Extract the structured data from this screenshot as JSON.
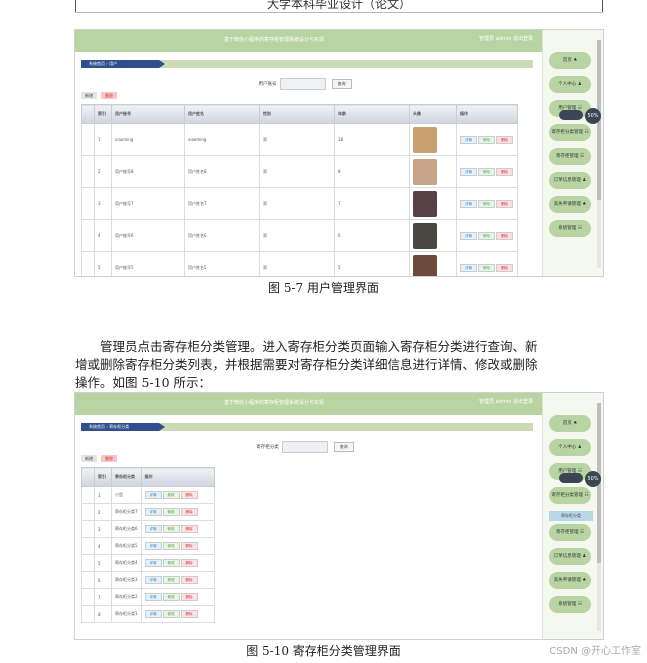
{
  "header": {
    "text": "大学本科毕业设计（论文）"
  },
  "shot1": {
    "system_title": "基于微信小程序的寄存柜管理系统设计与实现",
    "user_info": "管理员 admin 退出登录",
    "breadcrumb": "系统首页 › 用户",
    "search": {
      "label": "用户账号",
      "button": "查询"
    },
    "actions": {
      "add": "新增",
      "delete": "删除"
    },
    "columns": [
      "",
      "索引",
      "用户账号",
      "用户姓名",
      "性别",
      "年龄",
      "头像",
      "操作"
    ],
    "rows": [
      {
        "idx": "1",
        "account": "xiaoming",
        "name": "xiaoming",
        "gender": "男",
        "age": "18",
        "color": "#caa070"
      },
      {
        "idx": "2",
        "account": "用户账号8",
        "name": "用户姓名8",
        "gender": "男",
        "age": "8",
        "color": "#c6a489"
      },
      {
        "idx": "3",
        "account": "用户账号7",
        "name": "用户姓名7",
        "gender": "男",
        "age": "7",
        "color": "#574046"
      },
      {
        "idx": "4",
        "account": "用户账号6",
        "name": "用户姓名6",
        "gender": "男",
        "age": "6",
        "color": "#4a4642"
      },
      {
        "idx": "5",
        "account": "用户账号5",
        "name": "用户姓名5",
        "gender": "男",
        "age": "5",
        "color": "#6b4a3c"
      }
    ],
    "row_ops": [
      "详情",
      "修改",
      "删除"
    ],
    "sidebar": [
      "首页 ♠",
      "个人中心 ♟",
      "用户管理 ☷",
      "寄存柜分类管理 ☷",
      "寄存柜管理 ☰",
      "订单信息管理 ♟",
      "丢失申请管理 ♠",
      "系统管理 ☷"
    ],
    "badge": "50%",
    "caption": "图 5-7 用户管理界面"
  },
  "paragraph": {
    "line1": "管理员点击寄存柜分类管理。进入寄存柜分类页面输入寄存柜分类进行查询、新",
    "line2": "增或删除寄存柜分类列表，并根据需要对寄存柜分类详细信息进行详情、修改或删除",
    "line3": "操作。如图 5-10 所示："
  },
  "shot2": {
    "system_title": "基于微信小程序的寄存柜管理系统设计与实现",
    "user_info": "管理员 admin 退出登录",
    "breadcrumb": "系统首页 › 寄存柜分类",
    "search": {
      "label": "寄存柜分类",
      "button": "查询"
    },
    "actions": {
      "add": "新增",
      "delete": "删除"
    },
    "columns": [
      "",
      "索引",
      "寄存柜分类",
      "操作"
    ],
    "rows": [
      {
        "idx": "1",
        "name": "小型"
      },
      {
        "idx": "2",
        "name": "寄存柜分类7"
      },
      {
        "idx": "3",
        "name": "寄存柜分类6"
      },
      {
        "idx": "4",
        "name": "寄存柜分类5"
      },
      {
        "idx": "5",
        "name": "寄存柜分类4"
      },
      {
        "idx": "6",
        "name": "寄存柜分类3"
      },
      {
        "idx": "7",
        "name": "寄存柜分类2"
      },
      {
        "idx": "8",
        "name": "寄存柜分类1"
      }
    ],
    "row_ops": [
      "详情",
      "修改",
      "删除"
    ],
    "sidebar": [
      "首页 ♠",
      "个人中心 ♟",
      "用户管理 ☷",
      "寄存柜分类管理 ☷",
      "寄存柜分类",
      "寄存柜管理 ☰",
      "订单信息管理 ♟",
      "丢失申请管理 ♠",
      "系统管理 ☷"
    ],
    "badge": "50%",
    "caption": "图 5-10 寄存柜分类管理界面"
  },
  "watermark": "CSDN @开心工作室"
}
